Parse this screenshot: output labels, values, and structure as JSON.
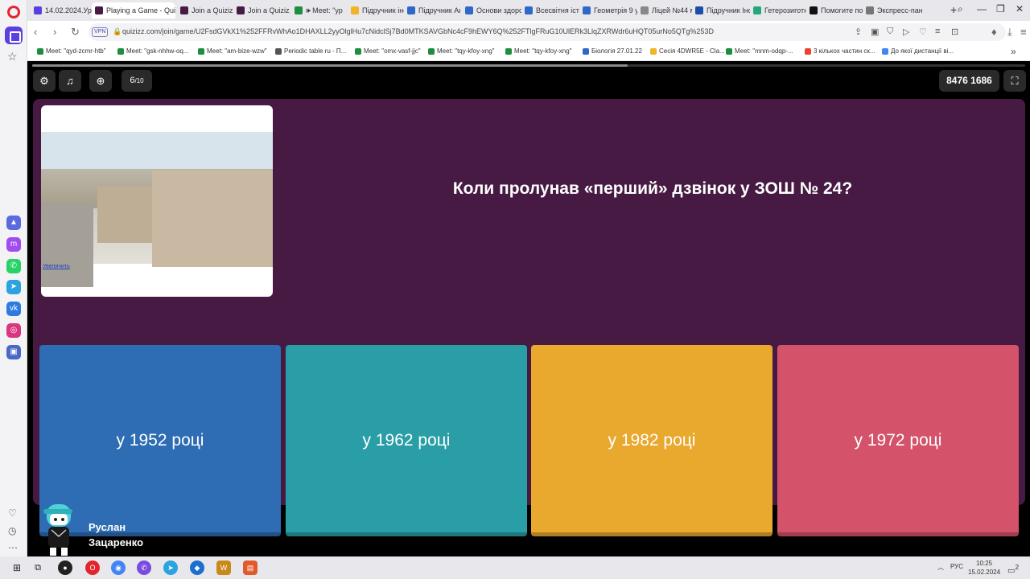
{
  "tabs": [
    {
      "label": "14.02.2024.Ур",
      "color": "#5a3fe0"
    },
    {
      "label": "Playing a Game - Quizizz",
      "color": "#461a42"
    },
    {
      "label": "Join a Quizizz",
      "color": "#461a42"
    },
    {
      "label": "Join a Quizizz",
      "color": "#461a42"
    },
    {
      "label": "🕪 Meet: \"ур",
      "color": "#1e8e3e"
    },
    {
      "label": "Підручник інф",
      "color": "#f0b429"
    },
    {
      "label": "Підручник Ан",
      "color": "#2f68c7"
    },
    {
      "label": "Основи здоро",
      "color": "#2f68c7"
    },
    {
      "label": "Всесвітня істо",
      "color": "#2f68c7"
    },
    {
      "label": "Геометрія 9 у",
      "color": "#2f68c7"
    },
    {
      "label": "Ліцей №44 м",
      "color": "#888888"
    },
    {
      "label": "Підручник Інф",
      "color": "#1a4ea8"
    },
    {
      "label": "Гетерозиготн",
      "color": "#22a87a"
    },
    {
      "label": "Помогите пол",
      "color": "#111111"
    },
    {
      "label": "Экспресс-пане",
      "color": "#777777"
    }
  ],
  "address": {
    "vpn": "VPN",
    "url": "quizizz.com/join/game/U2FsdGVkX1%252FFRvWhAo1DHAXLL2yyOlglHu7cNidclSj7Bd0MTKSAVGbNc4cF9hEWY6Q%252FTlgFRuG10UlERk3LlqZXRWdr6uHQT05urNo5QTg%253D"
  },
  "bookmarks": [
    {
      "label": "Meet: \"qyd-zcmr-htb\"",
      "color": "#1e8e3e"
    },
    {
      "label": "Meet: \"gsk-nhhw-oq...",
      "color": "#1e8e3e"
    },
    {
      "label": "Meet: \"am-bize-wzw\"",
      "color": "#1e8e3e"
    },
    {
      "label": "Periodic table ru - П...",
      "color": "#555555"
    },
    {
      "label": "Meet: \"omx-vasf-jjc\"",
      "color": "#1e8e3e"
    },
    {
      "label": "Meet: \"tqy-kfoy-xng\"",
      "color": "#1e8e3e"
    },
    {
      "label": "Meet: \"tqy-kfoy-xng\"",
      "color": "#1e8e3e"
    },
    {
      "label": "Біологія 27.01.22",
      "color": "#2f68c7"
    },
    {
      "label": "Сесія 4DWR5E - Cla...",
      "color": "#f0b429"
    },
    {
      "label": "Meet: \"mnm-odqp-...",
      "color": "#1e8e3e"
    },
    {
      "label": "3 кількох частин ск...",
      "color": "#ea4335"
    },
    {
      "label": "До якої дистанції ві...",
      "color": "#4285f4"
    }
  ],
  "quiz": {
    "progress": 0.6,
    "counter_current": "6",
    "counter_total": "/10",
    "game_code": "8476 1686",
    "question": "Коли пролунав «перший» дзвінок у ЗОШ № 24?",
    "image_link": "Увеличить",
    "options": [
      {
        "label": "у 1952 році",
        "color": "#2e6db3"
      },
      {
        "label": "у 1962 році",
        "color": "#2a9ea6"
      },
      {
        "label": "у 1982 році",
        "color": "#e9a82e"
      },
      {
        "label": "у 1972 році",
        "color": "#d4536b"
      }
    ],
    "player_first": "Руслан",
    "player_last": "Зацаренко"
  },
  "taskbar": {
    "lang": "РУС",
    "time": "10:25",
    "date": "15.02.2024",
    "notif": "2"
  }
}
